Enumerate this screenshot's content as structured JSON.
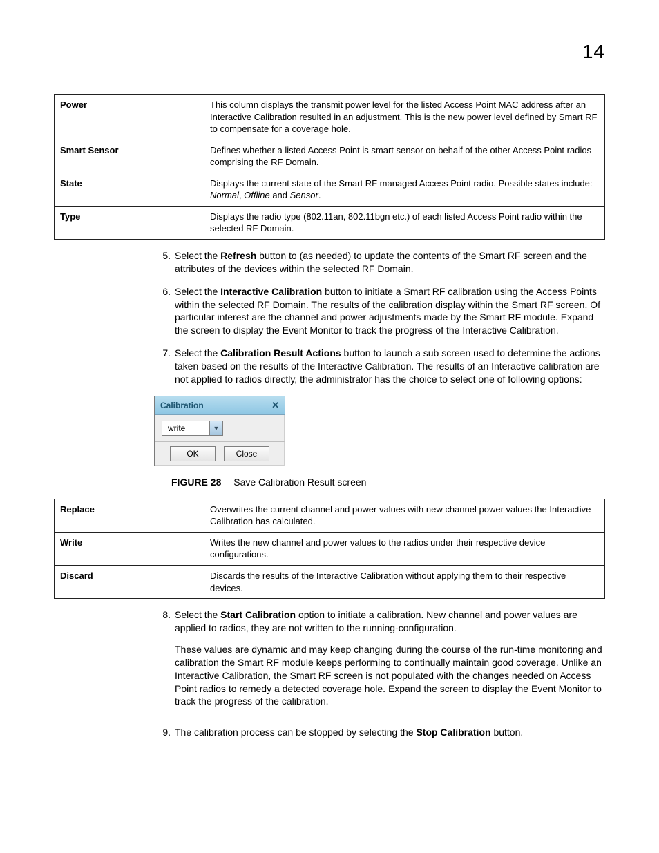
{
  "page_number": "14",
  "definitions1": [
    {
      "term": "Power",
      "desc": "This column displays the transmit power level for the listed Access Point MAC address after an Interactive Calibration resulted in an adjustment. This is the new power level defined by Smart RF to compensate for a coverage hole."
    },
    {
      "term": "Smart Sensor",
      "desc": "Defines whether a listed Access Point is smart sensor on behalf of the other Access Point radios comprising the RF Domain."
    },
    {
      "term": "State",
      "desc": [
        "Displays the current state of the Smart RF managed Access Point radio. Possible states include: ",
        "Normal",
        ", ",
        "Offline",
        " and ",
        "Sensor",
        "."
      ]
    },
    {
      "term": "Type",
      "desc": "Displays the radio type (802.11an, 802.11bgn etc.) of each listed Access Point radio within the selected RF Domain."
    }
  ],
  "step5": {
    "n": "5.",
    "pre": "Select the ",
    "bold": "Refresh",
    "post": " button to (as needed) to update the contents of the Smart RF screen and the attributes of the devices within the selected RF Domain."
  },
  "step6": {
    "n": "6.",
    "pre": "Select the ",
    "bold": "Interactive Calibration",
    "post": " button to initiate a Smart RF calibration using the Access Points within the selected RF Domain. The results of the calibration display within the Smart RF screen. Of particular interest are the channel and power adjustments made by the Smart RF module. Expand the screen to display the Event Monitor to track the progress of the Interactive Calibration."
  },
  "step7": {
    "n": "7.",
    "pre": "Select the ",
    "bold": "Calibration Result Actions",
    "post": " button to launch a sub screen used to determine the actions taken based on the results of the Interactive Calibration. The results of an Interactive calibration are not applied to radios directly, the administrator has the choice to select one of following options:"
  },
  "dialog": {
    "title": "Calibration",
    "close": "✕",
    "dropdown_value": "write",
    "caret": "▼",
    "ok": "OK",
    "close_btn": "Close"
  },
  "figure": {
    "label": "FIGURE 28",
    "caption": "Save Calibration Result screen"
  },
  "definitions2": [
    {
      "term": "Replace",
      "desc": "Overwrites the current channel and power values with new channel power values the Interactive Calibration has calculated."
    },
    {
      "term": "Write",
      "desc": "Writes the new channel and power values to the radios under their respective device configurations."
    },
    {
      "term": "Discard",
      "desc": "Discards the results of the Interactive Calibration without applying them to their respective devices."
    }
  ],
  "step8": {
    "n": "8.",
    "p1_pre": "Select the ",
    "p1_bold": "Start Calibration",
    "p1_post": " option to initiate a calibration. New channel and power values are applied to radios, they are not written to the running-configuration.",
    "p2": "These values are dynamic and may keep changing during the course of the run-time monitoring and calibration the Smart RF module keeps performing to continually maintain good coverage. Unlike an Interactive Calibration, the Smart RF screen is not populated with the changes needed on Access Point radios to remedy a detected coverage hole. Expand the screen to display the Event Monitor to track the progress of the calibration."
  },
  "step9": {
    "n": "9.",
    "pre": "The calibration process can be stopped by selecting the ",
    "bold": "Stop Calibration",
    "post": " button."
  }
}
